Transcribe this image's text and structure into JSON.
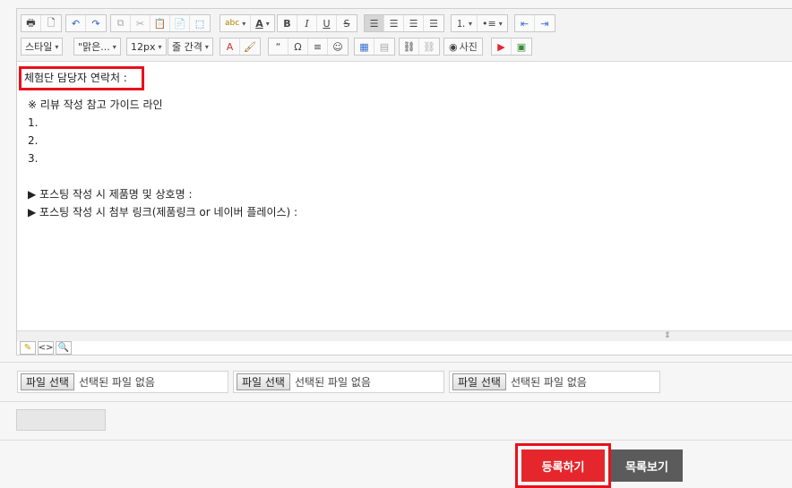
{
  "toolbar": {
    "style_label": "스타일",
    "font_label": "\"맑은...",
    "size_label": "12px",
    "line_spacing_label": "줄 간격",
    "photo_label": "사진",
    "quote_label": "“",
    "omega_label": "Ω",
    "bold": "B",
    "italic": "I",
    "underline": "U",
    "strike": "S",
    "text_color_label": "A",
    "spell_label": "abc"
  },
  "content": {
    "contact_line": "체험단 담당자 연락처 :",
    "guide_title": "※ 리뷰 작성 참고 가이드 라인",
    "items": [
      "1.",
      "2.",
      "3."
    ],
    "posting_name": "▶ 포스팅 작성 시 제품명 및 상호명 :",
    "posting_link": "▶ 포스팅 작성 시 첨부 링크(제품링크 or 네이버 플레이스) :"
  },
  "files": [
    {
      "button": "파일 선택",
      "status": "선택된 파일 없음"
    },
    {
      "button": "파일 선택",
      "status": "선택된 파일 없음"
    },
    {
      "button": "파일 선택",
      "status": "선택된 파일 없음"
    }
  ],
  "actions": {
    "submit_label": "등록하기",
    "list_label": "목록보기"
  },
  "colors": {
    "highlight": "#e8101a",
    "submit_bg": "#e5272d",
    "list_bg": "#5b5b5b"
  }
}
